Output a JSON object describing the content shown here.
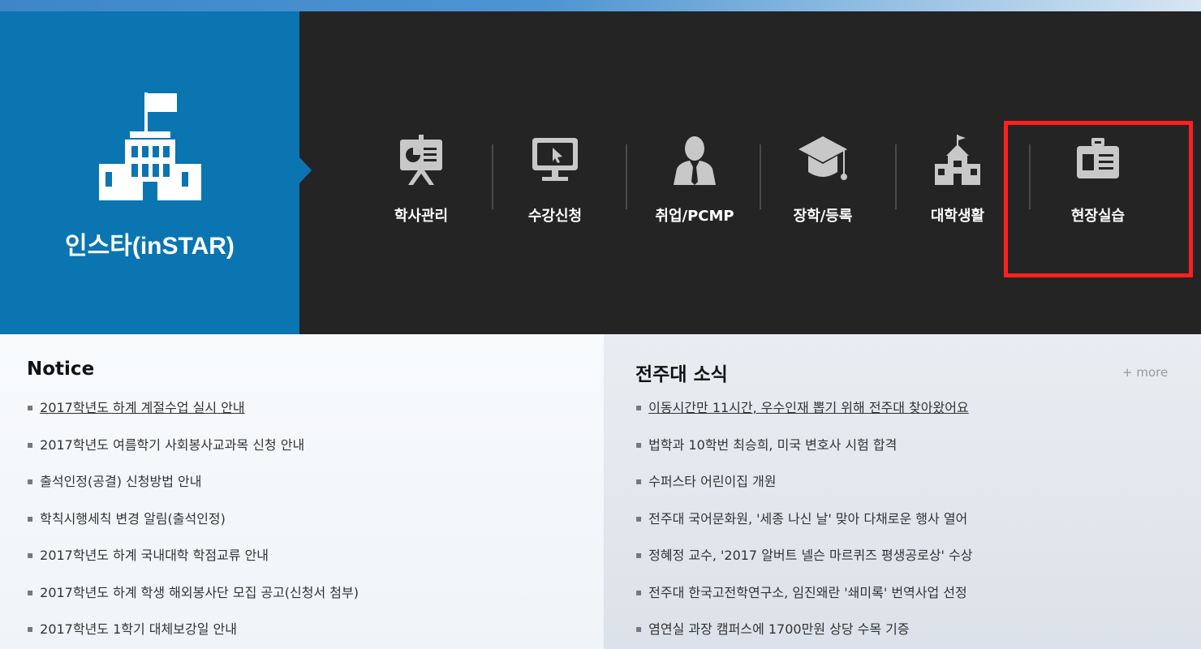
{
  "brand": {
    "title": "인스타(inSTAR)",
    "icon": "school-building-flag-icon",
    "color": "#0a75b1"
  },
  "menu": [
    {
      "label": "학사관리",
      "icon": "presentation-board-icon"
    },
    {
      "label": "수강신청",
      "icon": "monitor-cursor-icon"
    },
    {
      "label": "취업/PCMP",
      "icon": "person-suit-icon"
    },
    {
      "label": "장학/등록",
      "icon": "graduation-cap-icon"
    },
    {
      "label": "대학생활",
      "icon": "school-building-icon"
    },
    {
      "label": "현장실습",
      "icon": "id-badge-icon"
    }
  ],
  "highlight_color": "#ff1f1f",
  "notice": {
    "title": "Notice",
    "items": [
      "2017학년도 하계 계절수업 실시 안내",
      "2017학년도 여름학기 사회봉사교과목 신청 안내",
      "출석인정(공결) 신청방법 안내",
      "학칙시행세칙 변경 알림(출석인정)",
      "2017학년도 하계 국내대학 학점교류 안내",
      "2017학년도 하계 학생 해외봉사단 모집 공고(신청서 첨부)",
      "2017학년도 1학기 대체보강일 안내"
    ]
  },
  "news": {
    "title": "전주대 소식",
    "more": "+ more",
    "items": [
      "이동시간만 11시간, 우수인재 뽑기 위해 전주대 찾아왔어요",
      "법학과 10학번 최승희, 미국 변호사 시험 합격",
      "수퍼스타 어린이집 개원",
      "전주대 국어문화원, '세종 나신 날' 맞아 다채로운 행사 열어",
      "정혜정 교수, '2017 알버트 넬슨 마르퀴즈 평생공로상' 수상",
      "전주대 한국고전학연구소, 임진왜란 '쇄미록' 번역사업 선정",
      "염연실 과장 캠퍼스에 1700만원 상당 수목 기증"
    ]
  }
}
